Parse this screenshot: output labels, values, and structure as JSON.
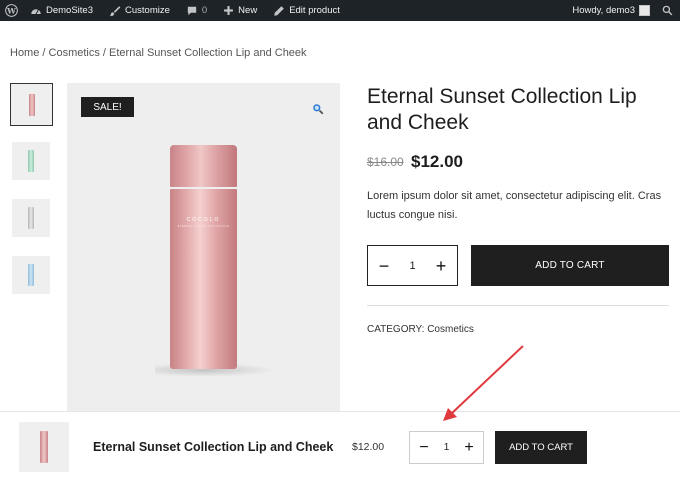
{
  "admin_bar": {
    "site_name": "DemoSite3",
    "customize": "Customize",
    "comments_count": "0",
    "new": "New",
    "edit_product": "Edit product",
    "howdy": "Howdy, demo3",
    "icons": [
      "wordpress-icon",
      "dashboard-icon",
      "brush-icon",
      "comment-icon",
      "plus-icon",
      "pencil-icon",
      "search-icon"
    ]
  },
  "breadcrumb": {
    "home": "Home",
    "sep1": " / ",
    "category": "Cosmetics",
    "sep2": " / ",
    "current": "Eternal Sunset Collection Lip and Cheek"
  },
  "gallery": {
    "sale_badge": "SALE!",
    "bottle_brand": "COCOLO",
    "bottle_sub": "ETERNAL SUNSET COLLECTION",
    "thumbnails": [
      {
        "name": "pink",
        "color": "#e3a9ab"
      },
      {
        "name": "mint",
        "color": "#a9dcc6"
      },
      {
        "name": "gray",
        "color": "#cfcfcf"
      },
      {
        "name": "blue",
        "color": "#a8cfe8"
      }
    ]
  },
  "product": {
    "title": "Eternal Sunset Collection Lip and Cheek",
    "price_old": "$16.00",
    "price_new": "$12.00",
    "description": "Lorem ipsum dolor sit amet, consectetur adipiscing elit. Cras luctus congue nisi.",
    "quantity": "1",
    "minus": "−",
    "plus": "+",
    "add_to_cart": "ADD TO CART",
    "category_label": "CATEGORY: ",
    "category_value": "Cosmetics"
  },
  "sticky_bar": {
    "title": "Eternal Sunset Collection Lip and Cheek",
    "price": "$12.00",
    "quantity": "1",
    "minus": "−",
    "plus": "+",
    "add_to_cart": "ADD TO CART"
  },
  "colors": {
    "admin_bar": "#1d2327",
    "button": "#1f1f1f",
    "arrow": "#e0393e"
  }
}
